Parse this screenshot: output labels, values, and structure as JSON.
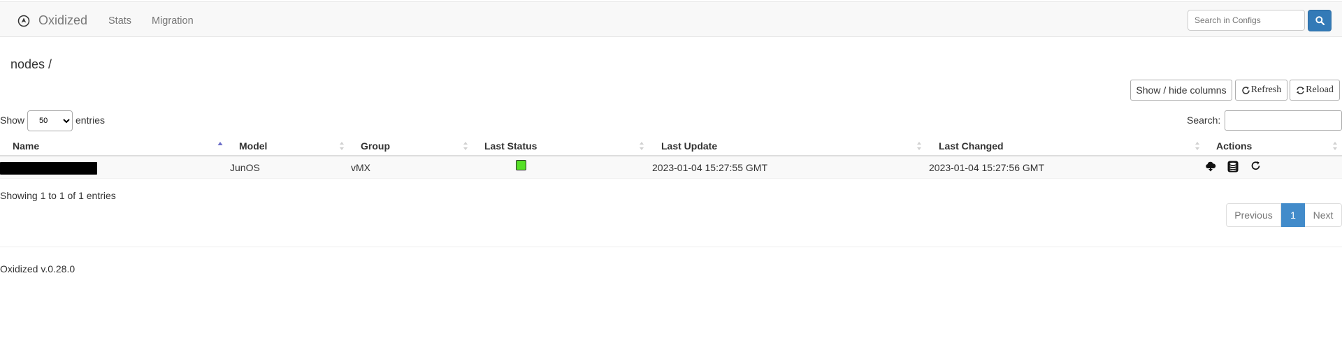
{
  "navbar": {
    "brand": "Oxidized",
    "links": [
      "Stats",
      "Migration"
    ],
    "search_placeholder": "Search in Configs"
  },
  "page": {
    "title": "nodes /"
  },
  "toolbar": {
    "columns_label": "Show / hide columns",
    "refresh_label": "Refresh",
    "reload_label": "Reload"
  },
  "table_controls": {
    "show_label": "Show",
    "entries_value": "50",
    "entries_label": "entries",
    "search_label": "Search:"
  },
  "table": {
    "columns": [
      "Name",
      "Model",
      "Group",
      "Last Status",
      "Last Update",
      "Last Changed",
      "Actions"
    ],
    "rows": [
      {
        "name": "",
        "model": "JunOS",
        "group": "vMX",
        "last_status": "success",
        "last_update": "2023-01-04 15:27:55 GMT",
        "last_changed": "2023-01-04 15:27:56 GMT"
      }
    ],
    "info": "Showing 1 to 1 of 1 entries"
  },
  "pagination": {
    "previous": "Previous",
    "current": "1",
    "next": "Next"
  },
  "footer": {
    "version": "Oxidized v.0.28.0"
  },
  "colors": {
    "primary": "#337ab7",
    "status_success": "#56e027"
  },
  "icons": [
    "oxidized-logo-icon",
    "search-icon",
    "refresh-icon",
    "reload-icon",
    "cloud-download-icon",
    "database-icon",
    "rotate-icon"
  ]
}
